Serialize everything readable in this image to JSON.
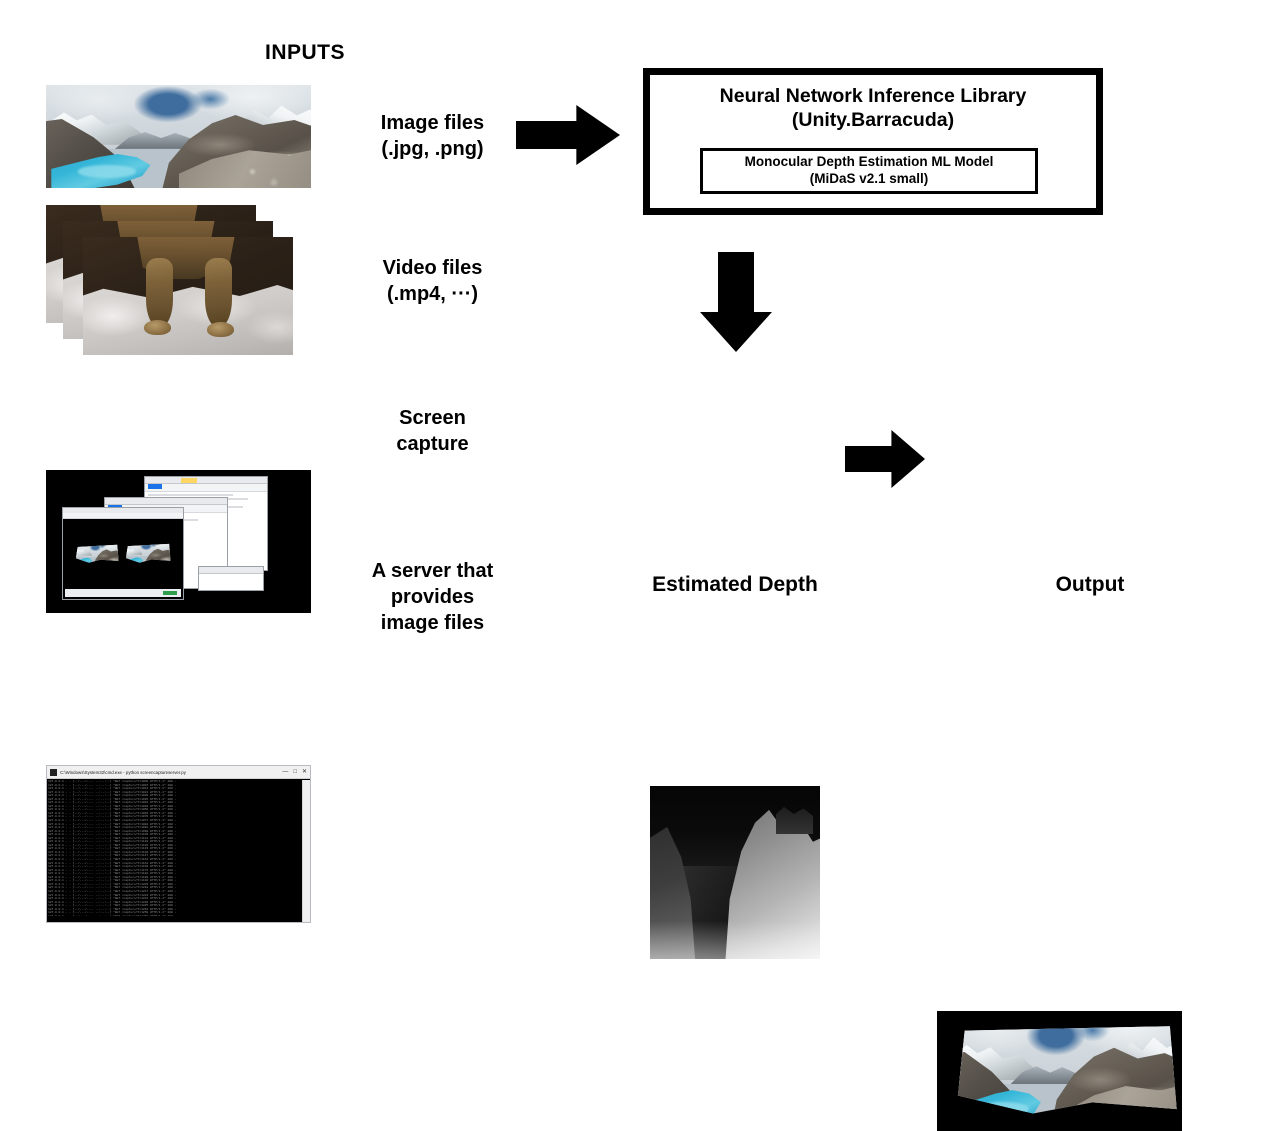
{
  "diagram": {
    "inputs_heading": "INPUTS",
    "inputs": [
      {
        "label": "Image files\n(.jpg, .png)",
        "thumb_name": "mountain-lake-photo"
      },
      {
        "label": "Video files\n(.mp4, ···)",
        "thumb_name": "cat-video-frames"
      },
      {
        "label": "Screen\ncapture",
        "thumb_name": "desktop-screen-capture"
      },
      {
        "label": "A server that\nprovides\nimage files",
        "thumb_name": "server-terminal"
      }
    ],
    "processor": {
      "title": "Neural Network Inference Library\n(Unity.Barracuda)",
      "model": "Monocular Depth Estimation ML Model\n(MiDaS v2.1 small)"
    },
    "results": [
      {
        "caption": "Estimated Depth",
        "thumb_name": "depth-map-image"
      },
      {
        "caption": "Output",
        "thumb_name": "output-3d-mesh-render"
      }
    ],
    "arrows": [
      {
        "name": "inputs-to-library-arrow",
        "direction": "right"
      },
      {
        "name": "library-to-depth-arrow",
        "direction": "down"
      },
      {
        "name": "depth-to-output-arrow",
        "direction": "right"
      }
    ],
    "terminal": {
      "title": "C:\\Windows\\System32\\cmd.exe - python  screencaptureserver.py",
      "minimize": "—",
      "maximize": "□",
      "close": "✕",
      "log_line": "127.0.0.1 - - [--/---/---- --:--:--] \"GET /capture?t=0000 HTTP/1.1\" 200 -"
    },
    "colors": {
      "background": "#ffffff",
      "ink": "#000000",
      "lake_blue": "#35b6d8",
      "terminal_bg": "#000000",
      "terminal_text": "#8a8a8a"
    }
  }
}
